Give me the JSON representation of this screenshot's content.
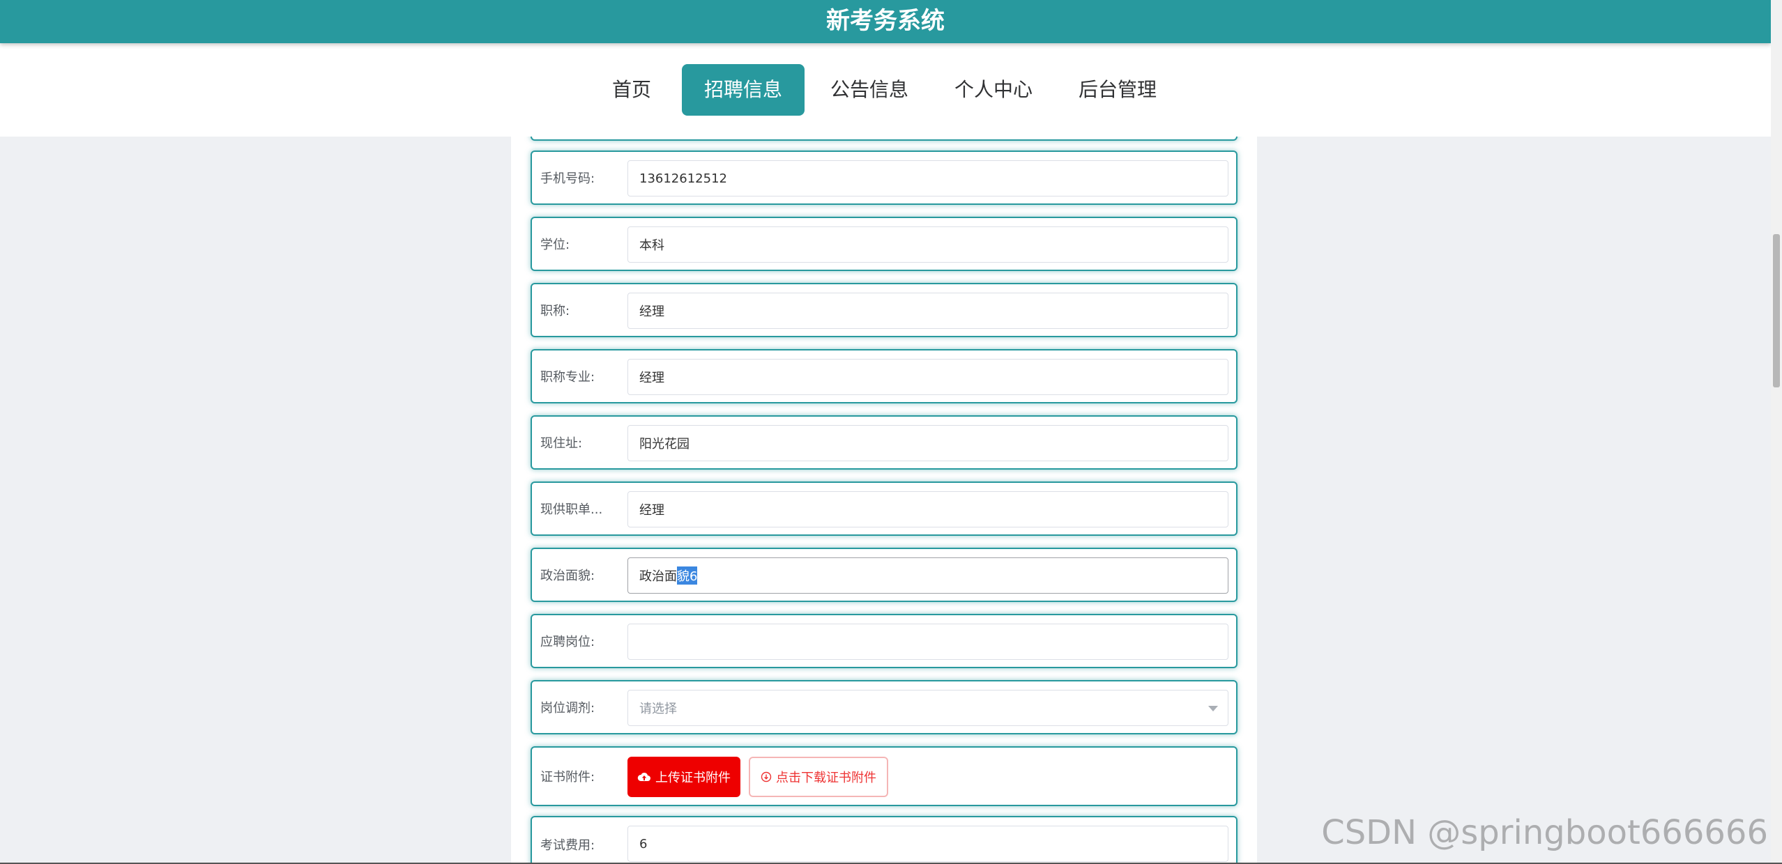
{
  "app": {
    "title": "新考务系统"
  },
  "nav": {
    "items": [
      {
        "label": "首页",
        "active": false
      },
      {
        "label": "招聘信息",
        "active": true
      },
      {
        "label": "公告信息",
        "active": false
      },
      {
        "label": "个人中心",
        "active": false
      },
      {
        "label": "后台管理",
        "active": false
      }
    ]
  },
  "form": {
    "phone": {
      "label": "手机号码:",
      "value": "13612612512"
    },
    "degree": {
      "label": "学位:",
      "value": "本科"
    },
    "title": {
      "label": "职称:",
      "value": "经理"
    },
    "title_major": {
      "label": "职称专业:",
      "value": "经理"
    },
    "address": {
      "label": "现住址:",
      "value": "阳光花园"
    },
    "current_unit": {
      "label": "现供职单...",
      "value": "经理"
    },
    "political": {
      "label": "政治面貌:",
      "value_prefix": "政治面",
      "value_selected": "貌6"
    },
    "position": {
      "label": "应聘岗位:",
      "value": ""
    },
    "adjust": {
      "label": "岗位调剂:",
      "placeholder": "请选择"
    },
    "certificate": {
      "label": "证书附件:",
      "upload_label": "上传证书附件",
      "download_label": "点击下载证书附件"
    },
    "fee": {
      "label": "考试费用:",
      "value": "6"
    }
  },
  "watermark": "CSDN @springboot666666",
  "colors": {
    "primary": "#28999e",
    "danger": "#ee0000"
  },
  "icons": {
    "upload": "cloud-upload-icon",
    "download": "download-circle-icon",
    "select": "chevron-down-icon"
  }
}
